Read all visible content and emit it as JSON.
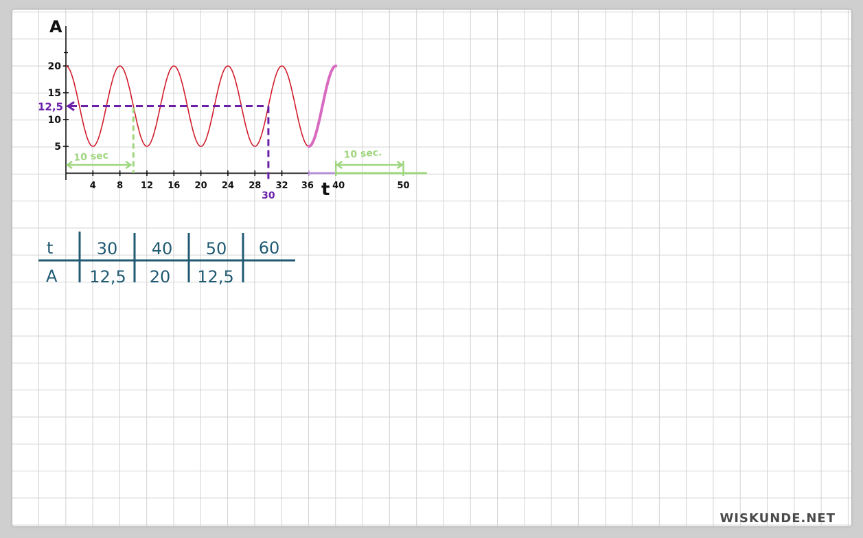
{
  "chart_data": {
    "type": "line",
    "xlabel": "t",
    "ylabel": "A",
    "x_ticks": [
      "4",
      "8",
      "12",
      "16",
      "20",
      "24",
      "28",
      "32",
      "36",
      "40",
      "50"
    ],
    "y_ticks": [
      "5",
      "10",
      "15",
      "20"
    ],
    "xlim": [
      0,
      53
    ],
    "ylim": [
      0,
      24
    ],
    "series": [
      {
        "color": "#d01c2c",
        "period": 8,
        "max": 20,
        "min": 5,
        "x_start": 0,
        "x_end": 36,
        "style": "thin"
      },
      {
        "color": "#d86ac0",
        "period": 8,
        "max": 20,
        "min": 5,
        "x_start": 36,
        "x_end": 40,
        "style": "thick"
      }
    ],
    "annotations": {
      "level_label": "12,5",
      "level_value": 12.5,
      "marker_x_value": 30,
      "marker_x_label": "30",
      "interval_label_1": "10 sec",
      "interval_1": [
        0,
        10
      ],
      "interval_label_2": "10 sec.",
      "interval_2": [
        40,
        50
      ],
      "colors": {
        "level": "#6a1fa8",
        "interval": "#9fd67f",
        "highlight": "#b88fd9"
      }
    }
  },
  "table": {
    "row_headers": [
      "t",
      "A"
    ],
    "t_values": [
      "30",
      "40",
      "50",
      "60"
    ],
    "A_values": [
      "12,5",
      "20",
      "12,5",
      ""
    ],
    "color": "#1f5a72"
  },
  "watermark": "WISKUNDE.NET"
}
